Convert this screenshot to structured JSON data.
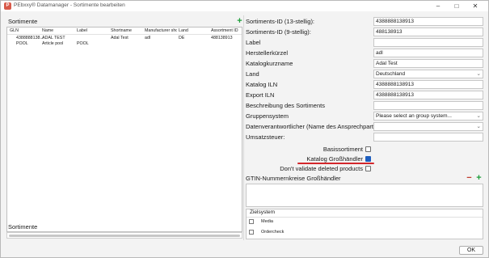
{
  "window": {
    "title": "PEbxxy® Datamanager - Sortimente bearbeiten",
    "app_icon": "app-icon",
    "minimize": "–",
    "maximize": "□",
    "close": "✕"
  },
  "left_panel": {
    "title": "Sortimente",
    "columns": [
      "GLN",
      "Name",
      "Label",
      "Shortname",
      "Manufacturer shc",
      "Land",
      "Assortment ID"
    ],
    "rows": [
      [
        "4388888138...",
        "ADAL TEST",
        "",
        "Adal Test",
        "adl",
        "DE",
        "488138913"
      ],
      [
        "POOL",
        "Article pool",
        "POOL",
        "",
        "",
        "",
        ""
      ]
    ],
    "bottom_label": "Sortimente"
  },
  "form": {
    "fields": [
      {
        "label": "Sortiments-ID (13-stellig):",
        "value": "4388888138913"
      },
      {
        "label": "Sortiments-ID (9-stellig):",
        "value": "488138913"
      },
      {
        "label": "Label",
        "value": ""
      },
      {
        "label": "Herstellerkürzel",
        "value": "adl"
      },
      {
        "label": "Katalogkurzname",
        "value": "Adal Test"
      },
      {
        "label": "Land",
        "value": "Deutschland"
      },
      {
        "label": "Katalog ILN",
        "value": "4388888138913"
      },
      {
        "label": "Export ILN",
        "value": "4388888138913"
      },
      {
        "label": "Beschreibung des Sortiments",
        "value": ""
      },
      {
        "label": "Gruppensystem",
        "value": "Please select an group system..."
      },
      {
        "label": "Datenverantwortlicher (Name des Ansprechpartners)",
        "value": ""
      },
      {
        "label": "Umsatzsteuer:",
        "value": ""
      }
    ],
    "checkboxes": [
      {
        "label": "Basissortiment",
        "checked": false
      },
      {
        "label": "Katalog Großhändler",
        "checked": true
      },
      {
        "label": "Don't validate deleted products",
        "checked": false
      }
    ],
    "gtin_label": "GTIN-Nummernkreise Großhändler",
    "zielsystem": {
      "title": "Zielsystem",
      "items": [
        "Media",
        "Ordercheck"
      ]
    },
    "ok_label": "OK"
  },
  "colors": {
    "accent": "#1f5fbf",
    "add": "#1e9e3a",
    "remove": "#c0392b",
    "highlight": "#d3272b"
  }
}
